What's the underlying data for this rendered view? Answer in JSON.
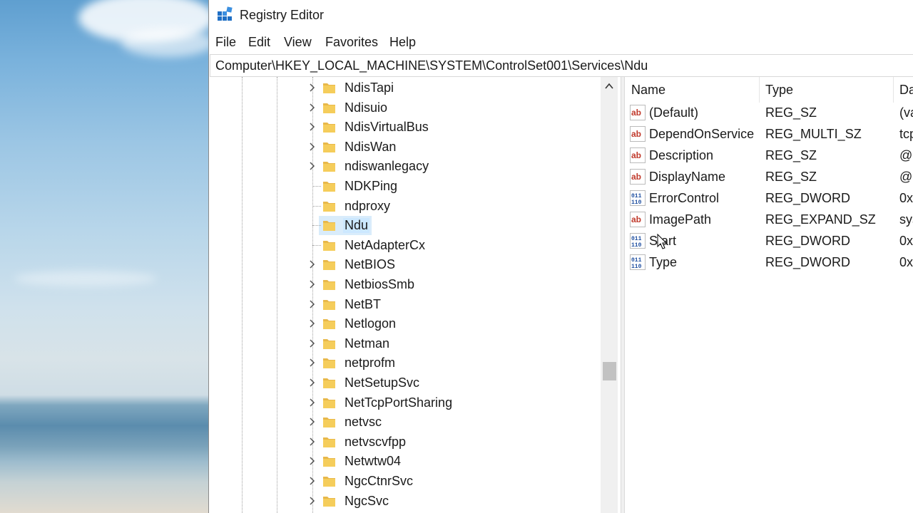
{
  "window": {
    "title": "Registry Editor",
    "accent": "#0078d7",
    "selection_color": "#cce8ff"
  },
  "menu": [
    "File",
    "Edit",
    "View",
    "Favorites",
    "Help"
  ],
  "address": "Computer\\HKEY_LOCAL_MACHINE\\SYSTEM\\ControlSet001\\Services\\Ndu",
  "tree": {
    "items": [
      {
        "label": "NdisTapi",
        "expandable": true
      },
      {
        "label": "Ndisuio",
        "expandable": true
      },
      {
        "label": "NdisVirtualBus",
        "expandable": true
      },
      {
        "label": "NdisWan",
        "expandable": true
      },
      {
        "label": "ndiswanlegacy",
        "expandable": true
      },
      {
        "label": "NDKPing",
        "expandable": false
      },
      {
        "label": "ndproxy",
        "expandable": false
      },
      {
        "label": "Ndu",
        "expandable": false,
        "selected": true
      },
      {
        "label": "NetAdapterCx",
        "expandable": false
      },
      {
        "label": "NetBIOS",
        "expandable": true
      },
      {
        "label": "NetbiosSmb",
        "expandable": true
      },
      {
        "label": "NetBT",
        "expandable": true
      },
      {
        "label": "Netlogon",
        "expandable": true
      },
      {
        "label": "Netman",
        "expandable": true
      },
      {
        "label": "netprofm",
        "expandable": true
      },
      {
        "label": "NetSetupSvc",
        "expandable": true
      },
      {
        "label": "NetTcpPortSharing",
        "expandable": true
      },
      {
        "label": "netvsc",
        "expandable": true
      },
      {
        "label": "netvscvfpp",
        "expandable": true
      },
      {
        "label": "Netwtw04",
        "expandable": true
      },
      {
        "label": "NgcCtnrSvc",
        "expandable": true
      },
      {
        "label": "NgcSvc",
        "expandable": true
      }
    ]
  },
  "values": {
    "columns": {
      "name": "Name",
      "type": "Type",
      "data": "Da"
    },
    "rows": [
      {
        "icon": "string-value-icon",
        "name": "(Default)",
        "type": "REG_SZ",
        "data": "(va"
      },
      {
        "icon": "string-value-icon",
        "name": "DependOnService",
        "type": "REG_MULTI_SZ",
        "data": "tcp"
      },
      {
        "icon": "string-value-icon",
        "name": "Description",
        "type": "REG_SZ",
        "data": "@"
      },
      {
        "icon": "string-value-icon",
        "name": "DisplayName",
        "type": "REG_SZ",
        "data": "@"
      },
      {
        "icon": "binary-value-icon",
        "name": "ErrorControl",
        "type": "REG_DWORD",
        "data": "0x"
      },
      {
        "icon": "string-value-icon",
        "name": "ImagePath",
        "type": "REG_EXPAND_SZ",
        "data": "sys"
      },
      {
        "icon": "binary-value-icon",
        "name": "Start",
        "type": "REG_DWORD",
        "data": "0x"
      },
      {
        "icon": "binary-value-icon",
        "name": "Type",
        "type": "REG_DWORD",
        "data": "0x"
      }
    ]
  }
}
